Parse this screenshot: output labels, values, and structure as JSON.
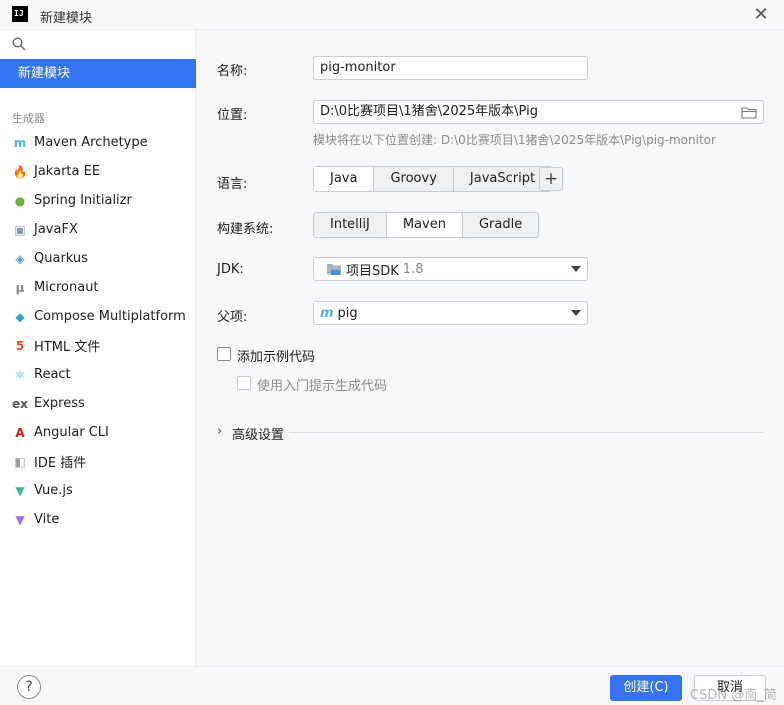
{
  "window": {
    "title": "新建模块",
    "logo_text": "IJ"
  },
  "sidebar": {
    "selected": "新建模块",
    "generators_header": "生成器",
    "generators": [
      {
        "label": "Maven Archetype",
        "icon": "maven-icon",
        "glyph": "m",
        "color": "#4bb6e8"
      },
      {
        "label": "Jakarta EE",
        "icon": "jakarta-icon",
        "glyph": "🔥",
        "color": "#f08c23"
      },
      {
        "label": "Spring Initializr",
        "icon": "spring-icon",
        "glyph": "●",
        "color": "#6db33f"
      },
      {
        "label": "JavaFX",
        "icon": "javafx-icon",
        "glyph": "▣",
        "color": "#8a9bb0"
      },
      {
        "label": "Quarkus",
        "icon": "quarkus-icon",
        "glyph": "◈",
        "color": "#4695eb"
      },
      {
        "label": "Micronaut",
        "icon": "micronaut-icon",
        "glyph": "μ",
        "color": "#888888"
      },
      {
        "label": "Compose Multiplatform",
        "icon": "compose-icon",
        "glyph": "◆",
        "color": "#2fa5d7"
      },
      {
        "label": "HTML 文件",
        "icon": "html5-icon",
        "glyph": "5",
        "color": "#e44d26"
      },
      {
        "label": "React",
        "icon": "react-icon",
        "glyph": "⚛",
        "color": "#3fb9e6"
      },
      {
        "label": "Express",
        "icon": "express-icon",
        "glyph": "ex",
        "color": "#555555"
      },
      {
        "label": "Angular CLI",
        "icon": "angular-icon",
        "glyph": "A",
        "color": "#dd1b16"
      },
      {
        "label": "IDE 插件",
        "icon": "ide-plugin-icon",
        "glyph": "◧",
        "color": "#9aa0a6"
      },
      {
        "label": "Vue.js",
        "icon": "vue-icon",
        "glyph": "▼",
        "color": "#41b883"
      },
      {
        "label": "Vite",
        "icon": "vite-icon",
        "glyph": "▼",
        "color": "#9a6cf6"
      }
    ]
  },
  "form": {
    "name_label": "名称:",
    "name_value": "pig-monitor",
    "location_label": "位置:",
    "location_value": "D:\\0比赛项目\\1猪舍\\2025年版本\\Pig",
    "location_hint": "模块将在以下位置创建: D:\\0比赛项目\\1猪舍\\2025年版本\\Pig\\pig-monitor",
    "language_label": "语言:",
    "languages": [
      "Java",
      "Groovy",
      "JavaScript"
    ],
    "language_selected": "Java",
    "plus_label": "+",
    "build_label": "构建系统:",
    "build_systems": [
      "IntelliJ",
      "Maven",
      "Gradle"
    ],
    "build_selected": "Maven",
    "jdk_label": "JDK:",
    "jdk_value": "项目SDK",
    "jdk_version": "1.8",
    "parent_label": "父项:",
    "parent_value": "pig",
    "sample_code_label": "添加示例代码",
    "onboarding_label": "使用入门提示生成代码",
    "advanced_label": "高级设置"
  },
  "footer": {
    "help_label": "?",
    "create_label": "创建(C)",
    "cancel_label": "取消",
    "watermark": "CSDN @南_简"
  },
  "colors": {
    "accent": "#3574f0"
  }
}
